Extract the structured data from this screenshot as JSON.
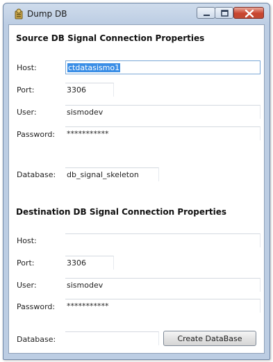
{
  "window": {
    "title": "Dump DB"
  },
  "source": {
    "heading": "Source DB Signal Connection  Properties",
    "host_label": "Host:",
    "host_value": "ctdatasismo1",
    "port_label": "Port:",
    "port_value": "3306",
    "user_label": "User:",
    "user_value": "sismodev",
    "password_label": "Password:",
    "password_value": "***********",
    "database_label": "Database:",
    "database_value": "db_signal_skeleton"
  },
  "destination": {
    "heading": "Destination DB Signal Connection  Properties",
    "host_label": "Host:",
    "host_value": "",
    "port_label": "Port:",
    "port_value": "3306",
    "user_label": "User:",
    "user_value": "sismodev",
    "password_label": "Password:",
    "password_value": "***********",
    "database_label": "Database:",
    "database_value": "",
    "create_button_label": "Create DataBase"
  }
}
